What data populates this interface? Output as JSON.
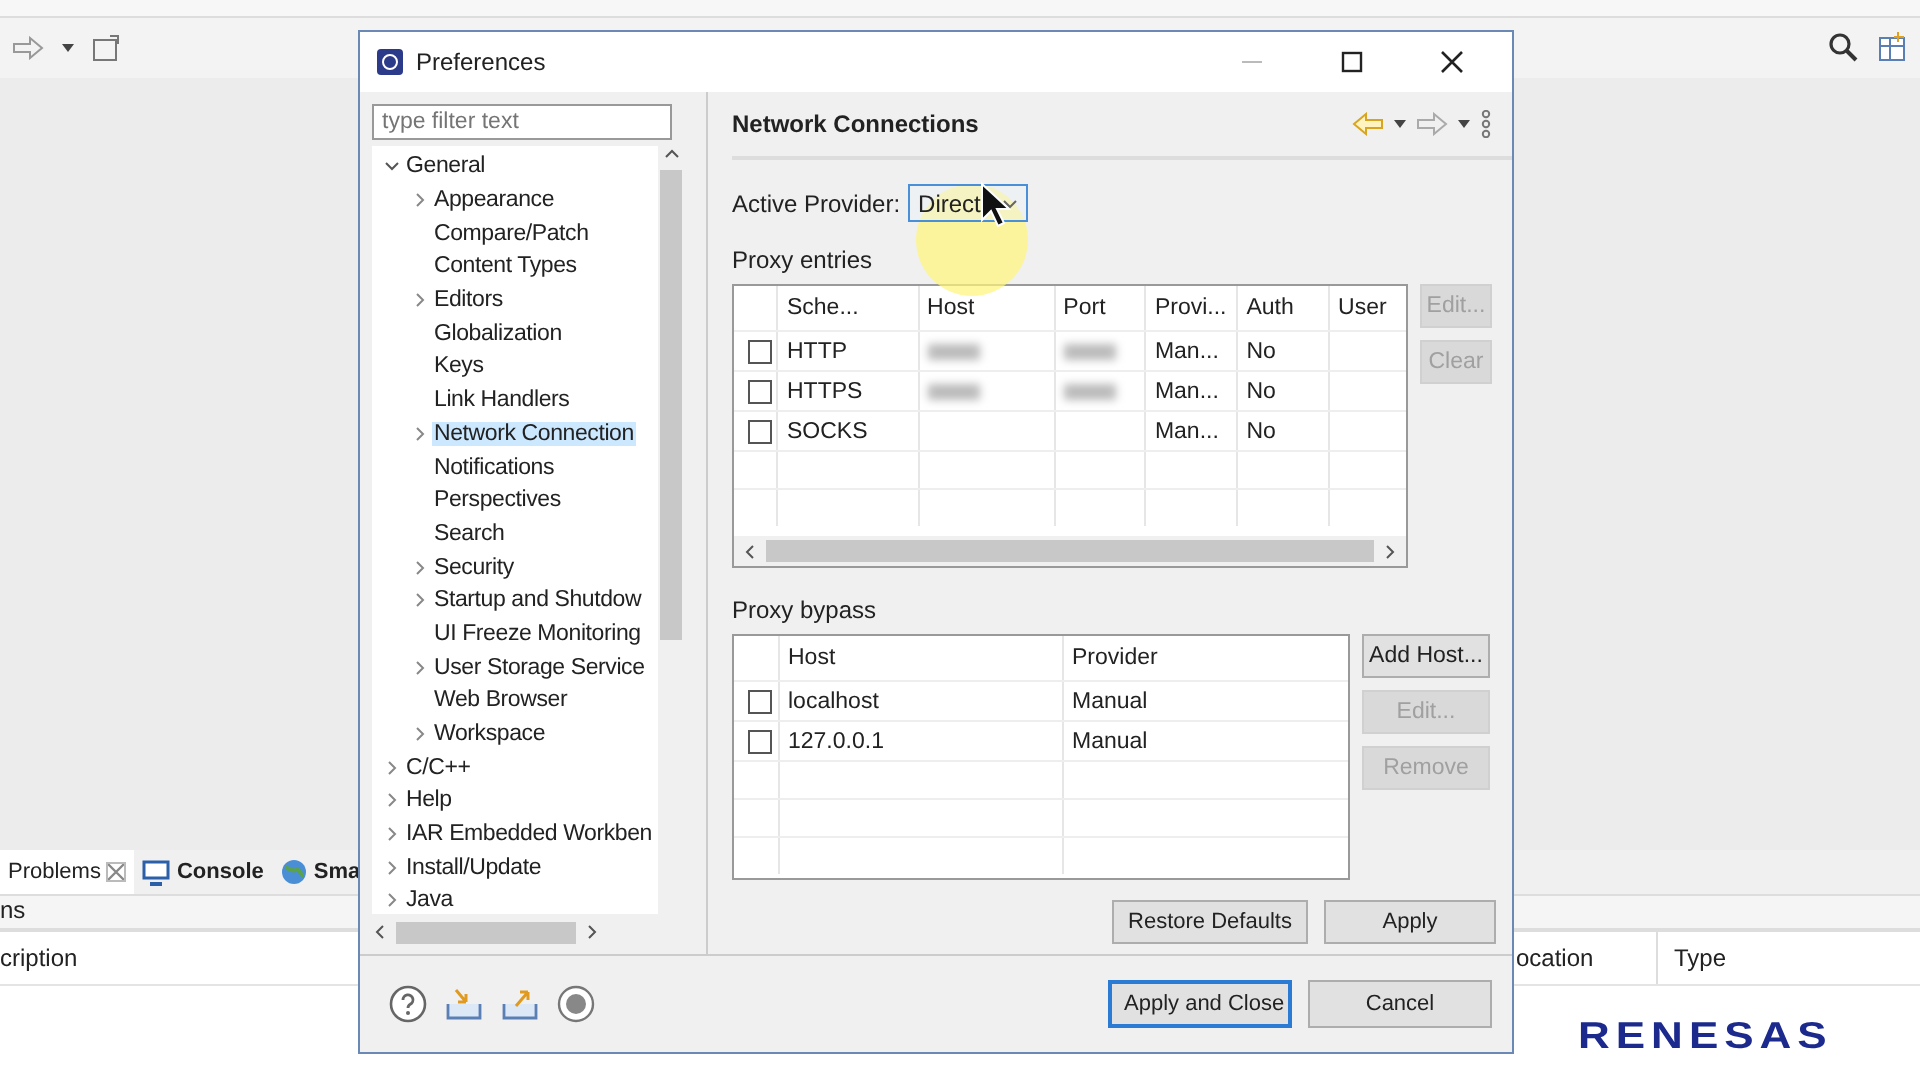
{
  "ide": {
    "bottom_panel": {
      "tabs": [
        {
          "label": "Problems",
          "selected": true
        },
        {
          "label": "Console",
          "selected": false
        },
        {
          "label": "Sma",
          "selected": false
        }
      ],
      "summary": "ns",
      "columns": [
        "cription",
        "ocation",
        "Type"
      ]
    },
    "logo": "RENESAS"
  },
  "dialog": {
    "title": "Preferences",
    "filter": {
      "placeholder": "type filter text"
    },
    "tree": [
      {
        "label": "General",
        "kind": "folder",
        "expanded": true,
        "selected": false,
        "children": [
          {
            "label": "Appearance",
            "kind": "folder",
            "expanded": false,
            "selected": false
          },
          {
            "label": "Compare/Patch",
            "kind": "leaf",
            "selected": false
          },
          {
            "label": "Content Types",
            "kind": "leaf",
            "selected": false
          },
          {
            "label": "Editors",
            "kind": "folder",
            "expanded": false,
            "selected": false
          },
          {
            "label": "Globalization",
            "kind": "leaf",
            "selected": false
          },
          {
            "label": "Keys",
            "kind": "leaf",
            "selected": false
          },
          {
            "label": "Link Handlers",
            "kind": "leaf",
            "selected": false
          },
          {
            "label": "Network Connection",
            "kind": "folder",
            "expanded": false,
            "selected": true
          },
          {
            "label": "Notifications",
            "kind": "leaf",
            "selected": false
          },
          {
            "label": "Perspectives",
            "kind": "leaf",
            "selected": false
          },
          {
            "label": "Search",
            "kind": "leaf",
            "selected": false
          },
          {
            "label": "Security",
            "kind": "folder",
            "expanded": false,
            "selected": false
          },
          {
            "label": "Startup and Shutdow",
            "kind": "folder",
            "expanded": false,
            "selected": false
          },
          {
            "label": "UI Freeze Monitoring",
            "kind": "leaf",
            "selected": false
          },
          {
            "label": "User Storage Service",
            "kind": "folder",
            "expanded": false,
            "selected": false
          },
          {
            "label": "Web Browser",
            "kind": "leaf",
            "selected": false
          },
          {
            "label": "Workspace",
            "kind": "folder",
            "expanded": false,
            "selected": false
          }
        ]
      },
      {
        "label": "C/C++",
        "kind": "folder",
        "expanded": false,
        "selected": false
      },
      {
        "label": "Help",
        "kind": "folder",
        "expanded": false,
        "selected": false
      },
      {
        "label": "IAR Embedded Workben",
        "kind": "folder",
        "expanded": false,
        "selected": false
      },
      {
        "label": "Install/Update",
        "kind": "folder",
        "expanded": false,
        "selected": false
      },
      {
        "label": "Java",
        "kind": "folder",
        "expanded": false,
        "selected": false
      }
    ],
    "page_title": "Network Connections",
    "active_provider": {
      "label": "Active Provider:",
      "value": "Direct"
    },
    "proxy_entries": {
      "label": "Proxy entries",
      "columns": [
        "Sche...",
        "Host",
        "Port",
        "Provi...",
        "Auth",
        "User"
      ],
      "rows": [
        {
          "checked": false,
          "scheme": "HTTP",
          "blurred": true,
          "provider": "Man...",
          "auth": "No"
        },
        {
          "checked": false,
          "scheme": "HTTPS",
          "blurred": true,
          "provider": "Man...",
          "auth": "No"
        },
        {
          "checked": false,
          "scheme": "SOCKS",
          "blurred": false,
          "provider": "Man...",
          "auth": "No"
        }
      ],
      "buttons": [
        {
          "label": "Edit...",
          "disabled": true
        },
        {
          "label": "Clear",
          "disabled": true
        }
      ]
    },
    "proxy_bypass": {
      "label": "Proxy bypass",
      "columns": [
        "Host",
        "Provider"
      ],
      "rows": [
        {
          "checked": false,
          "host": "localhost",
          "provider": "Manual"
        },
        {
          "checked": false,
          "host": "127.0.0.1",
          "provider": "Manual"
        }
      ],
      "buttons": [
        {
          "label": "Add Host...",
          "disabled": false
        },
        {
          "label": "Edit...",
          "disabled": true
        },
        {
          "label": "Remove",
          "disabled": true
        }
      ]
    },
    "page_buttons": [
      {
        "label": "Restore Defaults",
        "default": false
      },
      {
        "label": "Apply",
        "default": false
      }
    ],
    "footer_buttons": [
      {
        "label": "Apply and Close",
        "default": true
      },
      {
        "label": "Cancel",
        "default": false
      }
    ]
  }
}
